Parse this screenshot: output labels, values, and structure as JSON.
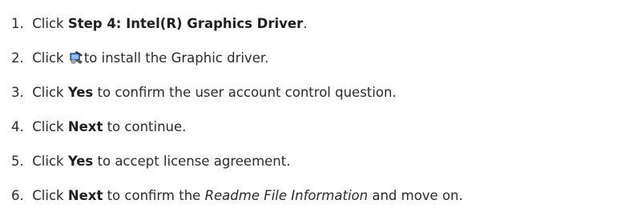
{
  "steps": [
    {
      "num": "1.",
      "prefix": "Click ",
      "bold": "Step 4: Intel(R) Graphics Driver",
      "suffix": "."
    },
    {
      "num": "2.",
      "prefix": "Click ",
      "icon": "installer-setup-icon",
      "suffix": "to install the Graphic driver."
    },
    {
      "num": "3.",
      "prefix": "Click ",
      "bold": "Yes",
      "suffix": " to confirm the user account control question."
    },
    {
      "num": "4.",
      "prefix": "Click ",
      "bold": "Next",
      "suffix": " to continue."
    },
    {
      "num": "5.",
      "prefix": "Click ",
      "bold": "Yes",
      "suffix": " to accept license agreement."
    },
    {
      "num": "6.",
      "prefix": "Click ",
      "bold": "Next",
      "middle": " to confirm the ",
      "italic": "Readme File Information",
      "suffix": " and move on."
    }
  ]
}
